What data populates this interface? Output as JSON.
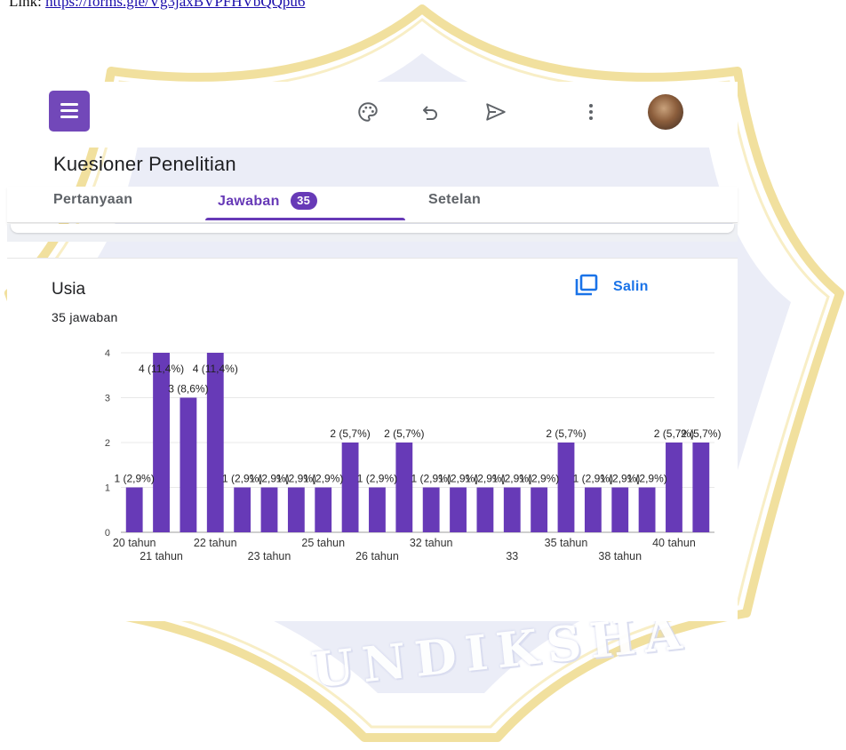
{
  "top_link": {
    "label": "Link:",
    "url_text": "https://forms.gle/Vg3jaxBVPFHVbQQpu6"
  },
  "watermark": {
    "text": "UNDIKSHA"
  },
  "toolbar": {
    "icons": [
      "forms-logo",
      "palette-icon",
      "undo-icon",
      "send-icon",
      "more-vert-icon",
      "avatar"
    ],
    "accent_color": "#673ab7",
    "logo_color": "#7248b9"
  },
  "form": {
    "title": "Kuesioner Penelitian"
  },
  "tabs": [
    {
      "label": "Pertanyaan"
    },
    {
      "label": "Jawaban",
      "badge": "35"
    },
    {
      "label": "Setelan"
    }
  ],
  "question": {
    "title": "Usia",
    "count_text": "35 jawaban",
    "copy_label": "Salin"
  },
  "chart_data": {
    "type": "bar",
    "color": "#673ab7",
    "ylim": [
      0,
      4
    ],
    "yticks": [
      0,
      1,
      2,
      3,
      4
    ],
    "grid": true,
    "values": [
      1,
      4,
      3,
      4,
      1,
      1,
      1,
      1,
      2,
      1,
      2,
      1,
      1,
      1,
      1,
      1,
      2,
      1,
      1,
      1,
      2,
      2
    ],
    "value_labels": [
      "1 (2,9%)",
      "4 (11,4%)",
      "3 (8,6%)",
      "4 (11,4%)",
      "1 (2,9%)",
      "1 (2,9%)",
      "1 (2,9%)",
      "1 (2,9%)",
      "2 (5,7%)",
      "1 (2,9%)",
      "2 (5,7%)",
      "1 (2,9%)",
      "1 (2,9%)",
      "1 (2,9%)",
      "1 (2,9%)",
      "1 (2,9%)",
      "2 (5,7%)",
      "1 (2,9%)",
      "1 (2,9%)",
      "1 (2,9%)",
      "2 (5,7%)",
      "2 (5,7%)"
    ],
    "tick_labels": [
      {
        "index": 0,
        "text": "20 tahun",
        "row": 0
      },
      {
        "index": 1,
        "text": "21 tahun",
        "row": 1
      },
      {
        "index": 3,
        "text": "22 tahun",
        "row": 0
      },
      {
        "index": 5,
        "text": "23 tahun",
        "row": 1
      },
      {
        "index": 7,
        "text": "25 tahun",
        "row": 0
      },
      {
        "index": 9,
        "text": "26 tahun",
        "row": 1
      },
      {
        "index": 11,
        "text": "32 tahun",
        "row": 0
      },
      {
        "index": 14,
        "text": "33",
        "row": 1
      },
      {
        "index": 16,
        "text": "35 tahun",
        "row": 0
      },
      {
        "index": 18,
        "text": "38 tahun",
        "row": 1
      },
      {
        "index": 20,
        "text": "40 tahun",
        "row": 0
      }
    ]
  }
}
